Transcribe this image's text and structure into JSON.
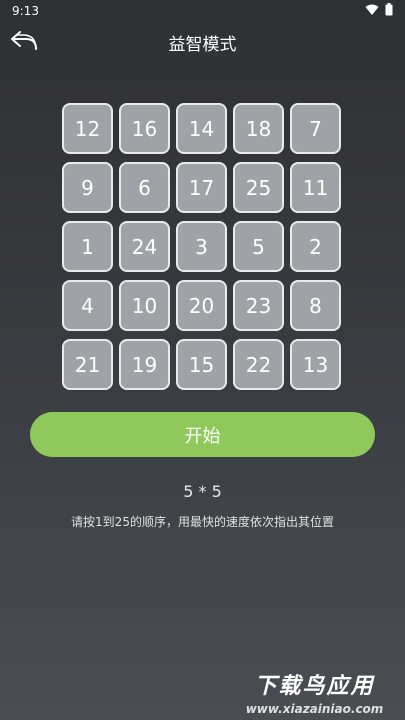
{
  "status_bar": {
    "time": "9:13"
  },
  "header": {
    "title": "益智模式"
  },
  "grid": {
    "cells": [
      12,
      16,
      14,
      18,
      7,
      9,
      6,
      17,
      25,
      11,
      1,
      24,
      3,
      5,
      2,
      4,
      10,
      20,
      23,
      8,
      21,
      19,
      15,
      22,
      13
    ]
  },
  "start_button": {
    "label": "开始"
  },
  "grid_size": "5 * 5",
  "instruction": "请按1到25的顺序，用最快的速度依次指出其位置",
  "watermark": {
    "main": "下载鸟应用",
    "sub": "www.xiazainiao.com"
  },
  "colors": {
    "accent": "#8fc95c",
    "tile": "#9fa2a6",
    "tile_border": "#e9eaeb"
  },
  "icons": [
    "wifi-icon",
    "battery-icon",
    "back-arrow-icon"
  ]
}
